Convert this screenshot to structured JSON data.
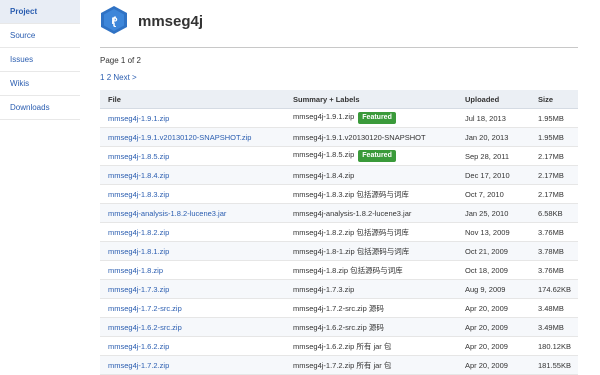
{
  "sidebar": {
    "items": [
      {
        "label": "Project"
      },
      {
        "label": "Source"
      },
      {
        "label": "Issues"
      },
      {
        "label": "Wikis"
      },
      {
        "label": "Downloads"
      }
    ]
  },
  "header": {
    "logo_letter": "P",
    "project_name": "mmseg4j"
  },
  "pagination": {
    "summary": "Page 1 of 2",
    "page1": "1",
    "page2": "2",
    "next": "Next >"
  },
  "table": {
    "columns": [
      "File",
      "Summary + Labels",
      "Uploaded",
      "Size"
    ],
    "featured_label": "Featured",
    "rows": [
      {
        "file": "mmseg4j-1.9.1.zip",
        "summary": "mmseg4j-1.9.1.zip",
        "featured": true,
        "uploaded": "Jul 18, 2013",
        "size": "1.95MB"
      },
      {
        "file": "mmseg4j-1.9.1.v20130120-SNAPSHOT.zip",
        "summary": "mmseg4j-1.9.1.v20130120-SNAPSHOT",
        "featured": false,
        "uploaded": "Jan 20, 2013",
        "size": "1.95MB"
      },
      {
        "file": "mmseg4j-1.8.5.zip",
        "summary": "mmseg4j-1.8.5.zip",
        "featured": true,
        "uploaded": "Sep 28, 2011",
        "size": "2.17MB"
      },
      {
        "file": "mmseg4j-1.8.4.zip",
        "summary": "mmseg4j-1.8.4.zip",
        "featured": false,
        "uploaded": "Dec 17, 2010",
        "size": "2.17MB"
      },
      {
        "file": "mmseg4j-1.8.3.zip",
        "summary": "mmseg4j-1.8.3.zip 包括源码与词库",
        "featured": false,
        "uploaded": "Oct 7, 2010",
        "size": "2.17MB"
      },
      {
        "file": "mmseg4j-analysis-1.8.2-lucene3.jar",
        "summary": "mmseg4j-analysis-1.8.2-lucene3.jar",
        "featured": false,
        "uploaded": "Jan 25, 2010",
        "size": "6.58KB"
      },
      {
        "file": "mmseg4j-1.8.2.zip",
        "summary": "mmseg4j-1.8.2.zip 包括源码与词库",
        "featured": false,
        "uploaded": "Nov 13, 2009",
        "size": "3.76MB"
      },
      {
        "file": "mmseg4j-1.8.1.zip",
        "summary": "mmseg4j-1.8-1.zip 包括源码与词库",
        "featured": false,
        "uploaded": "Oct 21, 2009",
        "size": "3.78MB"
      },
      {
        "file": "mmseg4j-1.8.zip",
        "summary": "mmseg4j-1.8.zip 包括源码与词库",
        "featured": false,
        "uploaded": "Oct 18, 2009",
        "size": "3.76MB"
      },
      {
        "file": "mmseg4j-1.7.3.zip",
        "summary": "mmseg4j-1.7.3.zip",
        "featured": false,
        "uploaded": "Aug 9, 2009",
        "size": "174.62KB"
      },
      {
        "file": "mmseg4j-1.7.2-src.zip",
        "summary": "mmseg4j-1.7.2-src.zip 源码",
        "featured": false,
        "uploaded": "Apr 20, 2009",
        "size": "3.48MB"
      },
      {
        "file": "mmseg4j-1.6.2-src.zip",
        "summary": "mmseg4j-1.6.2-src.zip 源码",
        "featured": false,
        "uploaded": "Apr 20, 2009",
        "size": "3.49MB"
      },
      {
        "file": "mmseg4j-1.6.2.zip",
        "summary": "mmseg4j-1.6.2.zip 所有 jar 包",
        "featured": false,
        "uploaded": "Apr 20, 2009",
        "size": "180.12KB"
      },
      {
        "file": "mmseg4j-1.7.2.zip",
        "summary": "mmseg4j-1.7.2.zip 所有 jar 包",
        "featured": false,
        "uploaded": "Apr 20, 2009",
        "size": "181.55KB"
      }
    ]
  },
  "colors": {
    "link": "#2a5db0",
    "featured_badge": "#3a9a3a",
    "logo": "#2f72c4"
  }
}
